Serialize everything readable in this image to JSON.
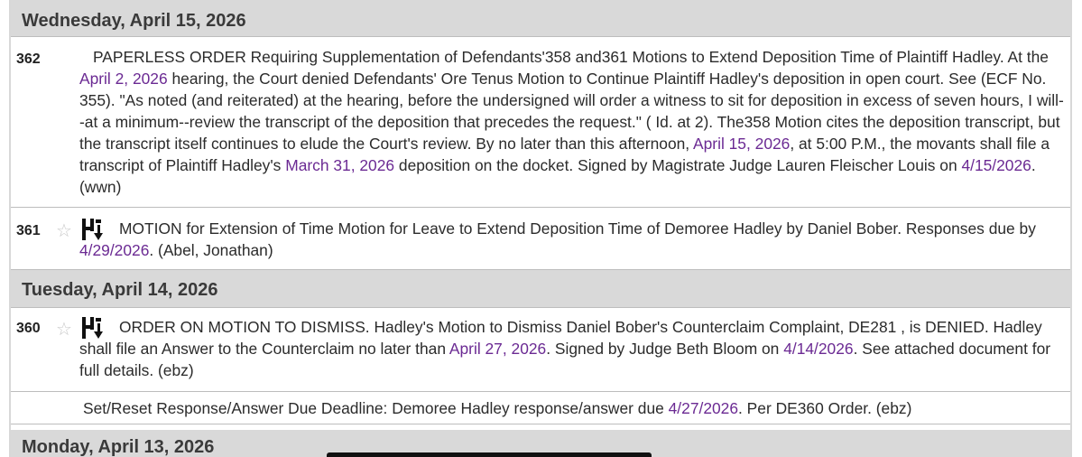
{
  "days": [
    {
      "label": "Wednesday, April 15, 2026"
    },
    {
      "label": "Tuesday, April 14, 2026"
    },
    {
      "label": "Monday, April 13, 2026"
    }
  ],
  "entries": {
    "e362": {
      "number": "362",
      "parts": [
        "PAPERLESS ORDER Requiring Supplementation of Defendants'358 and361 Motions to Extend Deposition Time of Plaintiff Hadley. At the ",
        "April 2, 2026",
        " hearing, the Court denied Defendants' Ore Tenus Motion to Continue Plaintiff Hadley's deposition in open court. See (ECF No. 355). \"As noted (and reiterated) at the hearing, before the undersigned will order a witness to sit for deposition in excess of seven hours, I will--at a minimum--review the transcript of the deposition that precedes the request.\" ( Id. at 2). The358 Motion cites the deposition transcript, but the transcript itself continues to elude the Court's review. By no later than this afternoon, ",
        "April 15, 2026",
        ", at 5:00 P.M., the movants shall file a transcript of Plaintiff Hadley's ",
        "March 31, 2026",
        " deposition on the docket. Signed by Magistrate Judge Lauren Fleischer Louis on ",
        "4/15/2026",
        ". (wwn)"
      ]
    },
    "e361": {
      "number": "361",
      "star": "☆",
      "icon": "document-download-icon",
      "parts": [
        "MOTION for Extension of Time Motion for Leave to Extend Deposition Time of Demoree Hadley by Daniel Bober. Responses due by ",
        "4/29/2026",
        ". (Abel, Jonathan)"
      ]
    },
    "e360": {
      "number": "360",
      "star": "☆",
      "icon": "document-download-icon",
      "parts": [
        "ORDER ON MOTION TO DISMISS. Hadley's Motion to Dismiss Daniel Bober's Counterclaim Complaint, DE281 , is DENIED. Hadley shall file an Answer to the Counterclaim no later than ",
        "April 27, 2026",
        ". Signed by Judge Beth Bloom on ",
        "4/14/2026",
        ". See attached document for full details. (ebz)"
      ]
    },
    "deadline": {
      "parts": [
        "Set/Reset Response/Answer Due Deadline: Demoree Hadley response/answer due ",
        "4/27/2026",
        ". Per DE360 Order. (ebz)"
      ]
    }
  },
  "colors": {
    "link": "#6b2a93",
    "header_bg": "#d9d9d9",
    "text": "#2b2b2b"
  }
}
